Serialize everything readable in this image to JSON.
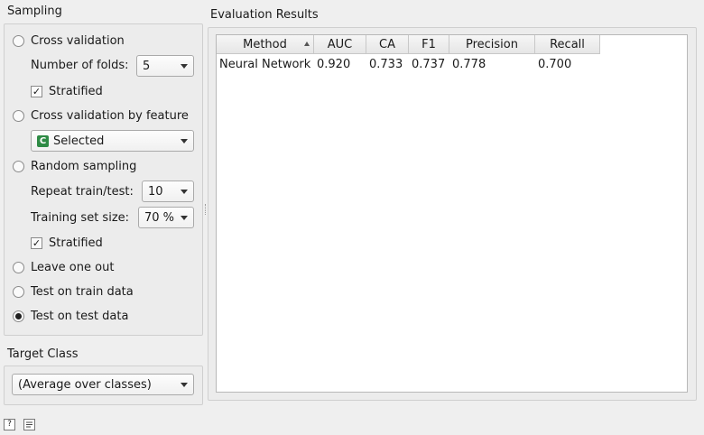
{
  "sampling": {
    "title": "Sampling",
    "cross_validation": {
      "label": "Cross validation",
      "selected": false
    },
    "folds": {
      "label": "Number of folds:",
      "value": "5"
    },
    "stratified_cv": {
      "label": "Stratified",
      "checked": true
    },
    "cv_by_feature": {
      "label": "Cross validation by feature",
      "selected": false
    },
    "feature": {
      "icon_letter": "C",
      "value": "Selected"
    },
    "random_sampling": {
      "label": "Random sampling",
      "selected": false
    },
    "repeat": {
      "label": "Repeat train/test:",
      "value": "10"
    },
    "train_size": {
      "label": "Training set size:",
      "value": "70 %"
    },
    "stratified_rs": {
      "label": "Stratified",
      "checked": true
    },
    "leave_one_out": {
      "label": "Leave one out",
      "selected": false
    },
    "test_on_train": {
      "label": "Test on train data",
      "selected": false
    },
    "test_on_test": {
      "label": "Test on test data",
      "selected": true
    }
  },
  "target_class": {
    "title": "Target Class",
    "value": "(Average over classes)"
  },
  "results": {
    "title": "Evaluation Results",
    "columns": [
      "Method",
      "AUC",
      "CA",
      "F1",
      "Precision",
      "Recall"
    ],
    "rows": [
      {
        "method": "Neural Network",
        "auc": "0.920",
        "ca": "0.733",
        "f1": "0.737",
        "precision": "0.778",
        "recall": "0.700"
      }
    ]
  },
  "footer": {
    "help_icon": "question-icon",
    "report_icon": "report-icon"
  },
  "colors": {
    "feature_icon": "#2e8b45",
    "background": "#efefef"
  }
}
